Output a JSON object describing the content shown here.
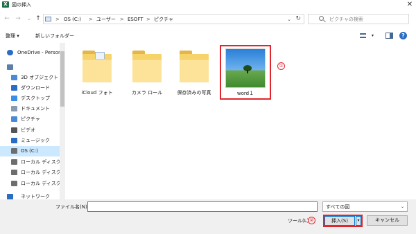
{
  "window": {
    "app_icon_letter": "X",
    "title": "図の挿入",
    "close_glyph": "✕"
  },
  "navigation": {
    "back_glyph": "←",
    "forward_glyph": "→",
    "recent_glyph": "⌄",
    "up_glyph": "↑",
    "breadcrumb": [
      "OS (C:)",
      "ユーザー",
      "ESOFT",
      "ピクチャ"
    ],
    "separator": ">",
    "refresh_glyph": "↻",
    "search_placeholder": "ピクチャの検索"
  },
  "toolbar": {
    "organize_label": "整理 ▾",
    "new_folder_label": "新しいフォルダー",
    "view_dd": "▾"
  },
  "sidebar": {
    "items": [
      {
        "label": "OneDrive - Person",
        "icon": "cloud-icon",
        "color": "#2b6cc4"
      },
      {
        "label": "",
        "icon": "pc-icon",
        "color": "#5b7fa8"
      },
      {
        "label": "3D オブジェクト",
        "icon": "cube-icon",
        "color": "#4a8ad6"
      },
      {
        "label": "ダウンロード",
        "icon": "download-icon",
        "color": "#2b6cc4"
      },
      {
        "label": "デスクトップ",
        "icon": "desktop-icon",
        "color": "#3b8ee5"
      },
      {
        "label": "ドキュメント",
        "icon": "document-icon",
        "color": "#8a9bb0"
      },
      {
        "label": "ピクチャ",
        "icon": "pictures-icon",
        "color": "#4a8ad6"
      },
      {
        "label": "ビデオ",
        "icon": "video-icon",
        "color": "#555555"
      },
      {
        "label": "ミュージック",
        "icon": "music-icon",
        "color": "#2b6cc4"
      },
      {
        "label": "OS (C:)",
        "icon": "drive-icon",
        "color": "#6d6d6d"
      },
      {
        "label": "ローカル ディスク (D",
        "icon": "drive-icon",
        "color": "#6d6d6d"
      },
      {
        "label": "ローカル ディスク (E",
        "icon": "drive-icon",
        "color": "#6d6d6d"
      },
      {
        "label": "ローカル ディスク (F",
        "icon": "drive-icon",
        "color": "#6d6d6d"
      },
      {
        "label": "ネットワーク",
        "icon": "network-icon",
        "color": "#2b6cc4"
      }
    ],
    "selected_index": 9
  },
  "files": [
    {
      "label": "iCloud フォト",
      "type": "folder"
    },
    {
      "label": "カメラ ロール",
      "type": "folder"
    },
    {
      "label": "保存済みの写真",
      "type": "folder"
    },
    {
      "label": "word１",
      "type": "image"
    }
  ],
  "annotations": {
    "mark1": "①",
    "mark2": "②"
  },
  "footer": {
    "filename_label": "ファイル名(N):",
    "filename_value": "",
    "filetype_value": "すべての図",
    "filetype_dd": "⌄",
    "tools_label": "ツール(L)",
    "insert_label": "挿入(S)",
    "insert_dd": "▾",
    "cancel_label": "キャンセル"
  },
  "colors": {
    "excel_green": "#1d7044",
    "selection_blue": "#cce8ff",
    "highlight_red": "#e0262c",
    "folder_yellow": "#f7d36b"
  }
}
